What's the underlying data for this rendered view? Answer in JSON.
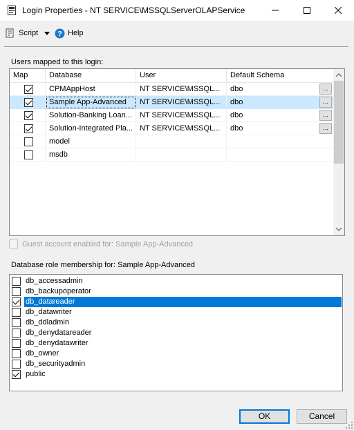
{
  "window": {
    "title": "Login Properties - NT SERVICE\\MSSQLServerOLAPService"
  },
  "toolbar": {
    "script_label": "Script",
    "help_label": "Help"
  },
  "users_section": {
    "label": "Users mapped to this login:",
    "columns": [
      "Map",
      "Database",
      "User",
      "Default Schema"
    ],
    "rows": [
      {
        "map": true,
        "database": "CPMAppHost",
        "user": "NT SERVICE\\MSSQL...",
        "schema": "dbo",
        "has_button": true,
        "selected": false
      },
      {
        "map": true,
        "database": "Sample App-Advanced",
        "user": "NT SERVICE\\MSSQL...",
        "schema": "dbo",
        "has_button": true,
        "selected": true
      },
      {
        "map": true,
        "database": "Solution-Banking Loan...",
        "user": "NT SERVICE\\MSSQL...",
        "schema": "dbo",
        "has_button": true,
        "selected": false
      },
      {
        "map": true,
        "database": "Solution-Integrated Pla...",
        "user": "NT SERVICE\\MSSQL...",
        "schema": "dbo",
        "has_button": true,
        "selected": false
      },
      {
        "map": false,
        "database": "model",
        "user": "",
        "schema": "",
        "has_button": false,
        "selected": false
      },
      {
        "map": false,
        "database": "msdb",
        "user": "",
        "schema": "",
        "has_button": false,
        "selected": false
      }
    ],
    "ellipsis_label": "..."
  },
  "guest": {
    "label": "Guest account enabled for: Sample App-Advanced",
    "checked": false
  },
  "roles_section": {
    "label": "Database role membership for: Sample App-Advanced",
    "roles": [
      {
        "name": "db_accessadmin",
        "checked": false,
        "selected": false
      },
      {
        "name": "db_backupoperator",
        "checked": false,
        "selected": false
      },
      {
        "name": "db_datareader",
        "checked": true,
        "selected": true
      },
      {
        "name": "db_datawriter",
        "checked": false,
        "selected": false
      },
      {
        "name": "db_ddladmin",
        "checked": false,
        "selected": false
      },
      {
        "name": "db_denydatareader",
        "checked": false,
        "selected": false
      },
      {
        "name": "db_denydatawriter",
        "checked": false,
        "selected": false
      },
      {
        "name": "db_owner",
        "checked": false,
        "selected": false
      },
      {
        "name": "db_securityadmin",
        "checked": false,
        "selected": false
      },
      {
        "name": "public",
        "checked": true,
        "selected": false
      }
    ]
  },
  "footer": {
    "ok_label": "OK",
    "cancel_label": "Cancel"
  },
  "colors": {
    "selection_blue": "#0078d7",
    "row_highlight": "#cce8ff"
  }
}
